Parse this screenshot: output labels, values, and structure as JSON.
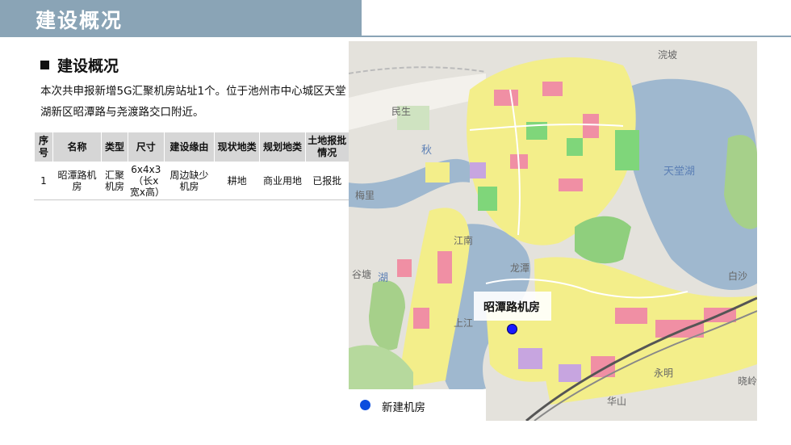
{
  "header": {
    "title": "建设概况"
  },
  "section": {
    "heading": "建设概况",
    "description": "本次共申报新增5G汇聚机房站址1个。位于池州市中心城区天堂湖新区昭潭路与尧渡路交口附近。"
  },
  "table": {
    "headers": [
      "序号",
      "名称",
      "类型",
      "尺寸",
      "建设缘由",
      "现状地类",
      "规划地类",
      "土地报批情况"
    ],
    "rows": [
      [
        "1",
        "昭潭路机房",
        "汇聚机房",
        "6x4x3（长x宽x高）",
        "周边缺少机房",
        "耕地",
        "商业用地",
        "已报批"
      ]
    ]
  },
  "map": {
    "labels": [
      "浣坡",
      "民生",
      "秋",
      "梅里",
      "谷塘",
      "湖",
      "江南",
      "上江",
      "龙潭",
      "永明",
      "晓岭",
      "华山",
      "白沙",
      "天堂湖"
    ],
    "callout": "昭潭路机房",
    "legend": {
      "label": "新建机房",
      "color": "#0b4dde"
    },
    "colors": {
      "water": "#9fb8cf",
      "residential": "#f3ee8a",
      "commercial": "#f08fa4",
      "green": "#7fd67a",
      "land": "#e4e2dc"
    }
  }
}
